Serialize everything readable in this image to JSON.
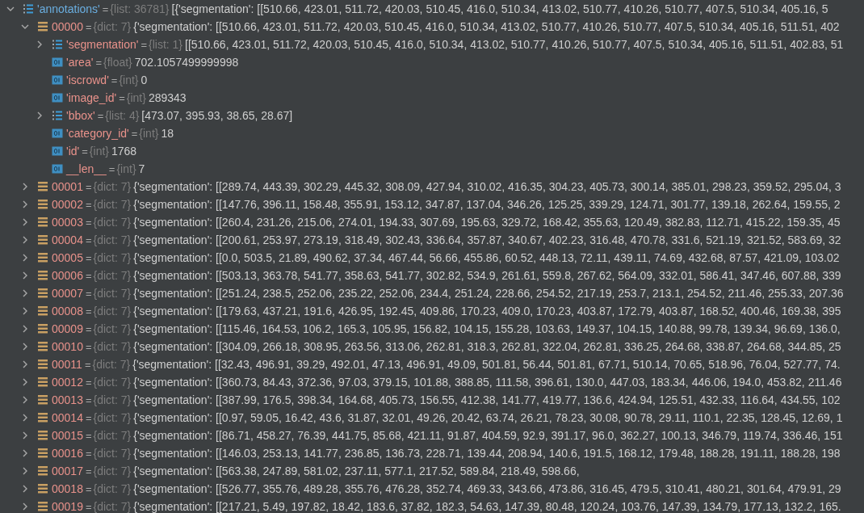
{
  "variables": [
    {
      "name": "'annotations'",
      "separator": "=",
      "type": "{list: 36781}",
      "value": "[{'segmentation': [[510.66, 423.01, 511.72, 420.03, 510.45, 416.0, 510.34, 413.02, 510.77, 410.26, 510.77, 407.5, 510.34, 405.16, 5",
      "kind": "list",
      "expanded": true,
      "children": [
        {
          "name": "00000",
          "separator": "=",
          "type": "{dict: 7}",
          "value": "{'segmentation': [[510.66, 423.01, 511.72, 420.03, 510.45, 416.0, 510.34, 413.02, 510.77, 410.26, 510.77, 407.5, 510.34, 405.16, 511.51, 402",
          "kind": "dict",
          "expanded": true,
          "children": [
            {
              "name": "'segmentation'",
              "separator": "=",
              "type": "{list: 1}",
              "value": "[[510.66, 423.01, 511.72, 420.03, 510.45, 416.0, 510.34, 413.02, 510.77, 410.26, 510.77, 407.5, 510.34, 405.16, 511.51, 402.83, 51",
              "kind": "list",
              "expanded": false
            },
            {
              "name": "'area'",
              "separator": "=",
              "type": "{float}",
              "value": "702.1057499999998",
              "kind": "scalar"
            },
            {
              "name": "'iscrowd'",
              "separator": "=",
              "type": "{int}",
              "value": "0",
              "kind": "scalar"
            },
            {
              "name": "'image_id'",
              "separator": "=",
              "type": "{int}",
              "value": "289343",
              "kind": "scalar"
            },
            {
              "name": "'bbox'",
              "separator": "=",
              "type": "{list: 4}",
              "value": "[473.07, 395.93, 38.65, 28.67]",
              "kind": "list",
              "expanded": false
            },
            {
              "name": "'category_id'",
              "separator": "=",
              "type": "{int}",
              "value": "18",
              "kind": "scalar"
            },
            {
              "name": "'id'",
              "separator": "=",
              "type": "{int}",
              "value": "1768",
              "kind": "scalar"
            },
            {
              "name": "__len__",
              "separator": "=",
              "type": "{int}",
              "value": "7",
              "kind": "scalar"
            }
          ]
        },
        {
          "name": "00001",
          "separator": "=",
          "type": "{dict: 7}",
          "value": "{'segmentation': [[289.74, 443.39, 302.29, 445.32, 308.09, 427.94, 310.02, 416.35, 304.23, 405.73, 300.14, 385.01, 298.23, 359.52, 295.04, 3",
          "kind": "dict",
          "expanded": false
        },
        {
          "name": "00002",
          "separator": "=",
          "type": "{dict: 7}",
          "value": "{'segmentation': [[147.76, 396.11, 158.48, 355.91, 153.12, 347.87, 137.04, 346.26, 125.25, 339.29, 124.71, 301.77, 139.18, 262.64, 159.55, 2",
          "kind": "dict",
          "expanded": false
        },
        {
          "name": "00003",
          "separator": "=",
          "type": "{dict: 7}",
          "value": "{'segmentation': [[260.4, 231.26, 215.06, 274.01, 194.33, 307.69, 195.63, 329.72, 168.42, 355.63, 120.49, 382.83, 112.71, 415.22, 159.35, 45",
          "kind": "dict",
          "expanded": false
        },
        {
          "name": "00004",
          "separator": "=",
          "type": "{dict: 7}",
          "value": "{'segmentation': [[200.61, 253.97, 273.19, 318.49, 302.43, 336.64, 357.87, 340.67, 402.23, 316.48, 470.78, 331.6, 521.19, 321.52, 583.69, 32",
          "kind": "dict",
          "expanded": false
        },
        {
          "name": "00005",
          "separator": "=",
          "type": "{dict: 7}",
          "value": "{'segmentation': [[0.0, 503.5, 21.89, 490.62, 37.34, 467.44, 56.66, 455.86, 60.52, 448.13, 72.11, 439.11, 74.69, 432.68, 87.57, 421.09, 103.02",
          "kind": "dict",
          "expanded": false
        },
        {
          "name": "00006",
          "separator": "=",
          "type": "{dict: 7}",
          "value": "{'segmentation': [[503.13, 363.78, 541.77, 358.63, 541.77, 302.82, 534.9, 261.61, 559.8, 267.62, 564.09, 332.01, 586.41, 347.46, 607.88, 339",
          "kind": "dict",
          "expanded": false
        },
        {
          "name": "00007",
          "separator": "=",
          "type": "{dict: 7}",
          "value": "{'segmentation': [[251.24, 238.5, 252.06, 235.22, 252.06, 234.4, 251.24, 228.66, 254.52, 217.19, 253.7, 213.1, 254.52, 211.46, 255.33, 207.36",
          "kind": "dict",
          "expanded": false
        },
        {
          "name": "00008",
          "separator": "=",
          "type": "{dict: 7}",
          "value": "{'segmentation': [[179.63, 437.21, 191.6, 426.95, 192.45, 409.86, 170.23, 409.0, 170.23, 403.87, 172.79, 403.87, 168.52, 400.46, 169.38, 395",
          "kind": "dict",
          "expanded": false
        },
        {
          "name": "00009",
          "separator": "=",
          "type": "{dict: 7}",
          "value": "{'segmentation': [[115.46, 164.53, 106.2, 165.3, 105.95, 156.82, 104.15, 155.28, 103.63, 149.37, 104.15, 140.88, 99.78, 139.34, 96.69, 136.0,",
          "kind": "dict",
          "expanded": false
        },
        {
          "name": "00010",
          "separator": "=",
          "type": "{dict: 7}",
          "value": "{'segmentation': [[304.09, 266.18, 308.95, 263.56, 313.06, 262.81, 318.3, 262.81, 322.04, 262.81, 336.25, 264.68, 338.87, 264.68, 344.85, 25",
          "kind": "dict",
          "expanded": false
        },
        {
          "name": "00011",
          "separator": "=",
          "type": "{dict: 7}",
          "value": "{'segmentation': [[32.43, 496.91, 39.29, 492.01, 47.13, 496.91, 49.09, 501.81, 56.44, 501.81, 67.71, 510.14, 70.65, 518.96, 76.04, 527.77, 74.",
          "kind": "dict",
          "expanded": false
        },
        {
          "name": "00012",
          "separator": "=",
          "type": "{dict: 7}",
          "value": "{'segmentation': [[360.73, 84.43, 372.36, 97.03, 379.15, 101.88, 388.85, 111.58, 396.61, 130.0, 447.03, 183.34, 446.06, 194.0, 453.82, 211.46",
          "kind": "dict",
          "expanded": false
        },
        {
          "name": "00013",
          "separator": "=",
          "type": "{dict: 7}",
          "value": "{'segmentation': [[387.99, 176.5, 398.34, 164.68, 405.73, 156.55, 412.38, 141.77, 419.77, 136.6, 424.94, 125.51, 432.33, 116.64, 434.55, 102",
          "kind": "dict",
          "expanded": false
        },
        {
          "name": "00014",
          "separator": "=",
          "type": "{dict: 7}",
          "value": "{'segmentation': [[0.97, 59.05, 16.42, 43.6, 31.87, 32.01, 49.26, 20.42, 63.74, 26.21, 78.23, 30.08, 90.78, 29.11, 110.1, 22.35, 128.45, 12.69, 1",
          "kind": "dict",
          "expanded": false
        },
        {
          "name": "00015",
          "separator": "=",
          "type": "{dict: 7}",
          "value": "{'segmentation': [[86.71, 458.27, 76.39, 441.75, 85.68, 421.11, 91.87, 404.59, 92.9, 391.17, 96.0, 362.27, 100.13, 346.79, 119.74, 336.46, 151",
          "kind": "dict",
          "expanded": false
        },
        {
          "name": "00016",
          "separator": "=",
          "type": "{dict: 7}",
          "value": "{'segmentation': [[146.03, 253.13, 141.77, 236.85, 136.73, 228.71, 139.44, 208.94, 140.6, 191.5, 168.12, 179.48, 188.28, 191.11, 188.28, 198",
          "kind": "dict",
          "expanded": false
        },
        {
          "name": "00017",
          "separator": "=",
          "type": "{dict: 7}",
          "value": "{'segmentation': [[563.38, 247.89, 581.02, 237.11, 577.1, 217.52, 589.84, 218.49, 598.66,",
          "kind": "dict",
          "expanded": false
        },
        {
          "name": "00018",
          "separator": "=",
          "type": "{dict: 7}",
          "value": "{'segmentation': [[526.77, 355.76, 489.28, 355.76, 476.28, 352.74, 469.33, 343.66, 473.86, 316.45, 479.5, 310.41, 480.21, 301.64, 479.91, 29",
          "kind": "dict",
          "expanded": false
        },
        {
          "name": "00019",
          "separator": "=",
          "type": "{dict: 7}",
          "value": "{'segmentation': [[217.21, 5.49, 197.82, 18.42, 183.6, 37.82, 182.3, 54.63, 147.39, 80.48, 120.24, 103.76, 147.39, 134.79, 177.13, 132.2, 165.",
          "kind": "dict",
          "expanded": false
        }
      ]
    }
  ]
}
